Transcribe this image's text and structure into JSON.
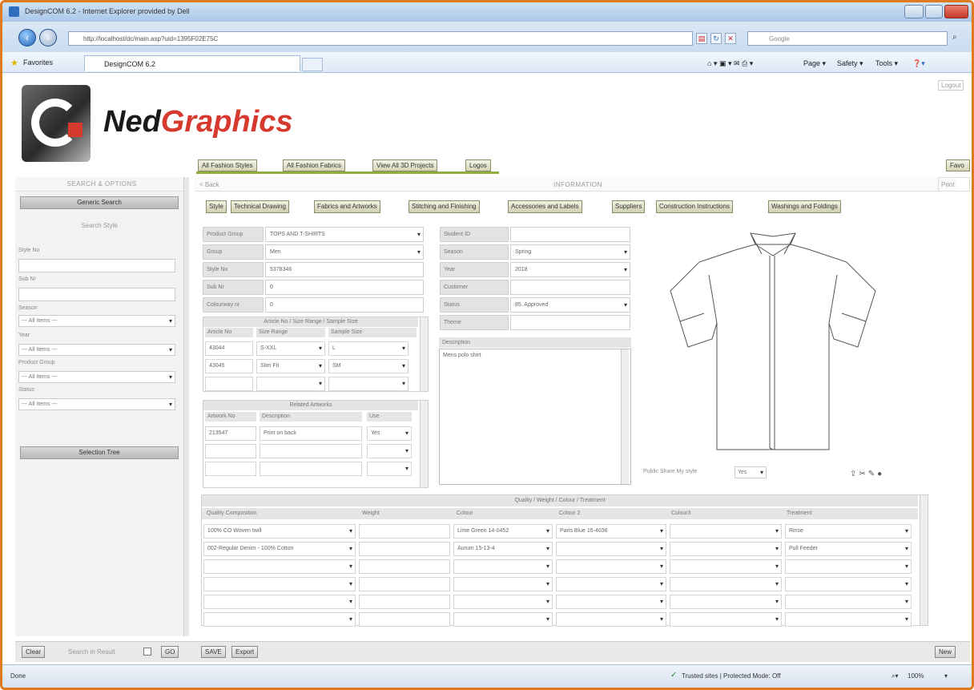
{
  "browser": {
    "window_title": "DesignCOM 6.2 - Internet Explorer provided by Dell",
    "address": "http://localhost/dc/main.asp?uid=1395F02E75C",
    "search_placeholder": "Google",
    "favorites_label": "Favorites",
    "tab_title": "DesignCOM 6.2",
    "commands": [
      "Page ▾",
      "Safety ▾",
      "Tools ▾"
    ],
    "status_left": "Done",
    "status_zone": "Trusted sites | Protected Mode: Off",
    "zoom": "100%"
  },
  "app": {
    "brand_part1": "Ned",
    "brand_part2": "Graphics",
    "logout": "Logout",
    "top_nav": [
      "All Fashion Styles",
      "All Fashion Fabrics",
      "View All 3D Projects",
      "Logos"
    ],
    "top_nav_right": "Favo",
    "accent_color": "#8fae3c"
  },
  "sidebar": {
    "header": "SEARCH & OPTIONS",
    "generic_search": "Generic Search",
    "search_style": "Search Style",
    "style_no_label": "Style No",
    "sub_nr_label": "Sub Nr",
    "season_label": "Season",
    "year_label": "Year",
    "product_group_label": "Product Group",
    "status_label": "Status",
    "all_items": "--- All Items ---",
    "selection_tree": "Selection Tree",
    "clear_btn": "Clear",
    "search_in_result": "Search in Result",
    "go_btn": "GO"
  },
  "main": {
    "back": "< Back",
    "info_header": "INFORMATION",
    "print": "Print",
    "tabs": [
      "Style",
      "Technical Drawing",
      "Fabrics and Artworks",
      "Stitching and Finishing",
      "Accessories and Labels",
      "Suppliers",
      "Construction Instructions",
      "Washings and Foldings"
    ],
    "left_fields": [
      {
        "label": "Product Group",
        "value": "TOPS AND T-SHIRTS",
        "select": true
      },
      {
        "label": "Group",
        "value": "Men",
        "select": true
      },
      {
        "label": "Style No",
        "value": "5378346",
        "select": false
      },
      {
        "label": "Sub Nr",
        "value": "0",
        "select": false
      },
      {
        "label": "Colourway nr",
        "value": "0",
        "select": false
      }
    ],
    "right_fields": [
      {
        "label": "Student ID",
        "value": "",
        "select": false
      },
      {
        "label": "Season",
        "value": "Spring",
        "select": true
      },
      {
        "label": "Year",
        "value": "2018",
        "select": true
      },
      {
        "label": "Customer",
        "value": "",
        "select": false
      },
      {
        "label": "Status",
        "value": "85. Approved",
        "select": true
      },
      {
        "label": "Theme",
        "value": "",
        "select": false
      }
    ],
    "article_grid": {
      "title": "Article No / Size Range / Sample Size",
      "headers": [
        "Article No",
        "Size Range",
        "Sample Size"
      ],
      "rows": [
        [
          "43044",
          "S-XXL",
          "L"
        ],
        [
          "43045",
          "Slim Fit",
          "SM"
        ],
        [
          "",
          "",
          ""
        ]
      ]
    },
    "artwork_grid": {
      "title": "Related Artworks",
      "headers": [
        "Artwork No",
        "Description",
        "Use"
      ],
      "rows": [
        [
          "213547",
          "Print on back",
          "Yes"
        ],
        [
          "",
          "",
          ""
        ],
        [
          "",
          "",
          ""
        ],
        [
          "",
          "",
          ""
        ]
      ]
    },
    "description_label": "Description",
    "description_value": "Mens polo shirt",
    "share_label": "Public Share My style",
    "share_value": "Yes",
    "quality_grid": {
      "title": "Quality / Weight / Colour / Treatment",
      "headers": [
        "Quality Composition",
        "Weight",
        "Colour",
        "Colour 2",
        "Colour3",
        "Treatment"
      ],
      "rows": [
        [
          "100% CO Woven twill",
          "",
          "Lime Green 14-0452",
          "Paris Blue 16-4036",
          "",
          "Rinse"
        ],
        [
          "002-Regular Denim - 100% Cotton",
          "",
          "Aurum 15-13-4",
          "",
          "",
          "Pull Feeder"
        ],
        [
          "",
          "",
          "",
          "",
          "",
          ""
        ],
        [
          "",
          "",
          "",
          "",
          "",
          ""
        ],
        [
          "",
          "",
          "",
          "",
          "",
          ""
        ],
        [
          "",
          "",
          "",
          "",
          "",
          ""
        ]
      ]
    },
    "save_btn": "SAVE",
    "export_btn": "Export",
    "new_btn": "New"
  }
}
